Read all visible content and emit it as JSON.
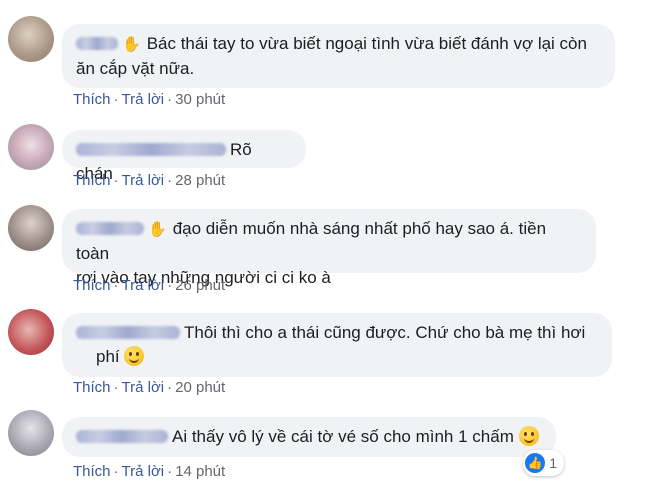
{
  "comments": [
    {
      "text_line1": "Bác thái tay to vừa biết ngoại tình vừa biết đánh vợ lại còn",
      "text_line2": "ăn cắp vặt nữa.",
      "like": "Thích",
      "reply": "Trả lời",
      "time": "30 phút",
      "avatar_colors": [
        "#b8a89a",
        "#d9c7b2"
      ]
    },
    {
      "text_line1": "Rõ chán",
      "like": "Thích",
      "reply": "Trả lời",
      "time": "28 phút",
      "avatar_colors": [
        "#c9b0b8",
        "#e6d3d9"
      ]
    },
    {
      "text_line1": "đạo diễn muốn nhà sáng nhất phố hay sao á. tiền toàn",
      "text_line2": "rơi vào tay những người ci ci ko à",
      "like": "Thích",
      "reply": "Trả lời",
      "time": "26 phút",
      "avatar_colors": [
        "#8d7f7b",
        "#c2b5ad"
      ]
    },
    {
      "text_line1": "Thôi thì cho a thái cũng được. Chứ cho bà mẹ thì hơi",
      "text_line2": "phí",
      "like": "Thích",
      "reply": "Trả lời",
      "time": "20 phút",
      "avatar_colors": [
        "#b54a4d",
        "#e0a3a2"
      ]
    },
    {
      "text_line1": "Ai thấy vô lý về cái tờ vé số cho mình 1 chấm",
      "like": "Thích",
      "reply": "Trả lời",
      "time": "14 phút",
      "reaction_count": "1",
      "avatar_colors": [
        "#a6a4ad",
        "#d2d1d6"
      ]
    }
  ],
  "separator": "·",
  "icons": {
    "wave": "waving-hand-icon",
    "laugh": "laughing-emoji-icon",
    "smile": "smiling-emoji-icon",
    "like": "thumbs-up-icon"
  },
  "colors": {
    "bubble_bg": "#f0f2f5",
    "action_link": "#385898",
    "meta_text": "#65676b",
    "like_blue": "#1877f2"
  }
}
